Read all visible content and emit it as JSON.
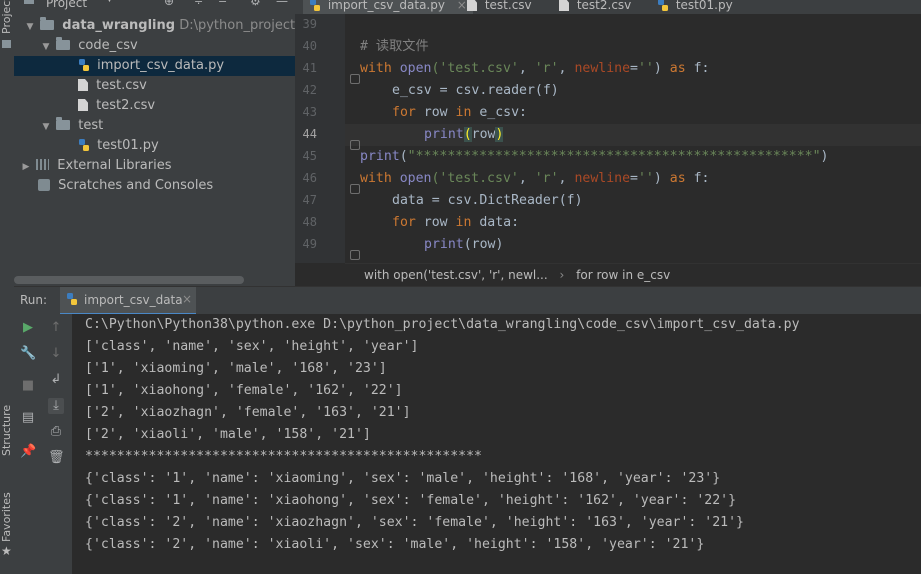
{
  "left_strip": {
    "project_tab": "Project",
    "structure_tab": "Structure",
    "favorites_tab": "Favorites"
  },
  "project_panel": {
    "title": "Project",
    "tree": [
      {
        "label": "data_wrangling",
        "path": "D:\\python_project\\data_",
        "type": "folder",
        "depth": 0,
        "expanded": true
      },
      {
        "label": "code_csv",
        "type": "folder",
        "depth": 1,
        "expanded": true
      },
      {
        "label": "import_csv_data.py",
        "type": "python",
        "depth": 2,
        "selected": true
      },
      {
        "label": "test.csv",
        "type": "csv",
        "depth": 2
      },
      {
        "label": "test2.csv",
        "type": "csv",
        "depth": 2
      },
      {
        "label": "test",
        "type": "folder",
        "depth": 1,
        "expanded": true
      },
      {
        "label": "test01.py",
        "type": "python",
        "depth": 2
      },
      {
        "label": "External Libraries",
        "type": "libraries",
        "depth": 0,
        "expanded": false
      },
      {
        "label": "Scratches and Consoles",
        "type": "scratches",
        "depth": 0
      }
    ]
  },
  "editor": {
    "tabs": [
      {
        "label": "import_csv_data.py",
        "active": true
      },
      {
        "label": "test.csv"
      },
      {
        "label": "test2.csv"
      },
      {
        "label": "test01.py"
      }
    ],
    "line_numbers": [
      "39",
      "40",
      "41",
      "42",
      "43",
      "44",
      "45",
      "46",
      "47",
      "48",
      "49"
    ],
    "current_line": "44",
    "code": {
      "l40": "# 读取文件",
      "l41_kw": "with",
      "l41_fn": "open",
      "l41_a": "('test.csv'",
      "l41_b": "'r'",
      "l41_param": "newline",
      "l41_c": "''",
      "l41_as": "as",
      "l41_f": " f:",
      "l42": "e_csv = csv.reader(f)",
      "l43_for": "for",
      "l43_row": " row ",
      "l43_in": "in",
      "l43_rest": " e_csv:",
      "l44_print": "print",
      "l44_arg": "row",
      "l45_print": "print",
      "l45_str": "\"**************************************************\"",
      "l46_kw": "with",
      "l46_fn": "open",
      "l46_a": "('test.csv'",
      "l46_b": "'r'",
      "l46_param": "newline",
      "l46_c": "''",
      "l46_as": "as",
      "l46_f": " f:",
      "l47": "data = csv.DictReader(f)",
      "l48_for": "for",
      "l48_row": " row ",
      "l48_in": "in",
      "l48_rest": " data:",
      "l49_print": "print",
      "l49_arg": "(row)"
    },
    "breadcrumb": [
      "with open('test.csv', 'r', newl...",
      "for row in e_csv"
    ]
  },
  "run": {
    "label": "Run:",
    "tab": "import_csv_data",
    "output": [
      "C:\\Python\\Python38\\python.exe D:\\python_project\\data_wrangling\\code_csv\\import_csv_data.py",
      "['class', 'name', 'sex', 'height', 'year']",
      "['1', 'xiaoming', 'male', '168', '23']",
      "['1', 'xiaohong', 'female', '162', '22']",
      "['2', 'xiaozhagn', 'female', '163', '21']",
      "['2', 'xiaoli', 'male', '158', '21']",
      "**************************************************",
      "{'class': '1', 'name': 'xiaoming', 'sex': 'male', 'height': '168', 'year': '23'}",
      "{'class': '1', 'name': 'xiaohong', 'sex': 'female', 'height': '162', 'year': '22'}",
      "{'class': '2', 'name': 'xiaozhagn', 'sex': 'female', 'height': '163', 'year': '21'}",
      "{'class': '2', 'name': 'xiaoli', 'sex': 'male', 'height': '158', 'year': '21'}"
    ]
  },
  "colors": {
    "keyword": "#cc7832",
    "string": "#6a8759",
    "comment": "#808080",
    "builtin": "#8888c6",
    "param": "#aa4926",
    "selection": "#0d293e"
  }
}
